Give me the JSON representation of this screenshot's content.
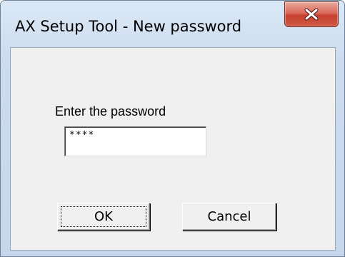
{
  "window": {
    "title": "AX Setup Tool - New password",
    "close_icon": "close-x-icon"
  },
  "form": {
    "prompt_label": "Enter the password",
    "password_value": "****"
  },
  "buttons": {
    "ok_label": "OK",
    "cancel_label": "Cancel"
  },
  "colors": {
    "title_bar": "#cddcef",
    "close_button": "#c7402f",
    "client_area": "#f0f0f0"
  }
}
